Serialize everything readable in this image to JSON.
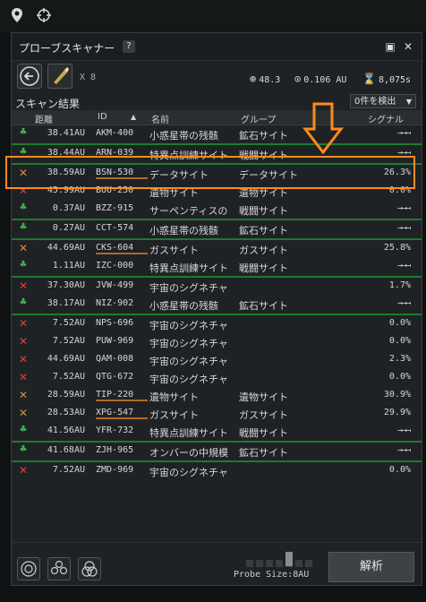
{
  "window": {
    "title": "プローブスキャナー",
    "help": "?"
  },
  "toolbar": {
    "probe_count": "X 8",
    "stat1": "48.3",
    "stat2": "0.106 AU",
    "stat3": "8,075s"
  },
  "results": {
    "label": "スキャン結果",
    "detect": "0件を検出"
  },
  "columns": [
    "距離",
    "ID",
    "名前",
    "グループ",
    "シグナル"
  ],
  "rows": [
    {
      "type": "green",
      "dist": "38.41AU",
      "id": "AKM-400",
      "name": "小惑星帯の残骸",
      "group": "鉱石サイト",
      "signal": "→→→"
    },
    {
      "type": "green",
      "dist": "38.44AU",
      "id": "ARN-039",
      "name": "特異点訓練サイト",
      "group": "戦闘サイト",
      "signal": "→→→"
    },
    {
      "type": "x-or",
      "dist": "38.59AU",
      "id": "BSN-530",
      "name": "データサイト",
      "group": "データサイト",
      "signal": "26.3%"
    },
    {
      "type": "x-red",
      "dist": "45.99AU",
      "id": "BUU-250",
      "name": "遺物サイト",
      "group": "遺物サイト",
      "signal": "0.0%"
    },
    {
      "type": "green",
      "dist": "0.37AU",
      "id": "BZZ-915",
      "name": "サーペンティスの",
      "group": "戦闘サイト",
      "signal": "→→→"
    },
    {
      "type": "green",
      "dist": "0.27AU",
      "id": "CCT-574",
      "name": "小惑星帯の残骸",
      "group": "鉱石サイト",
      "signal": "→→→"
    },
    {
      "type": "x-or",
      "dist": "44.69AU",
      "id": "CKS-604",
      "name": "ガスサイト",
      "group": "ガスサイト",
      "signal": "25.8%"
    },
    {
      "type": "green",
      "dist": "1.11AU",
      "id": "IZC-000",
      "name": "特異点訓練サイト",
      "group": "戦闘サイト",
      "signal": "→→→"
    },
    {
      "type": "x-red",
      "dist": "37.30AU",
      "id": "JVW-499",
      "name": "宇宙のシグネチャ",
      "group": "",
      "signal": "1.7%"
    },
    {
      "type": "green",
      "dist": "38.17AU",
      "id": "NIZ-902",
      "name": "小惑星帯の残骸",
      "group": "鉱石サイト",
      "signal": "→→→"
    },
    {
      "type": "x-red",
      "dist": "7.52AU",
      "id": "NPS-696",
      "name": "宇宙のシグネチャ",
      "group": "",
      "signal": "0.0%"
    },
    {
      "type": "x-red",
      "dist": "7.52AU",
      "id": "PUW-969",
      "name": "宇宙のシグネチャ",
      "group": "",
      "signal": "0.0%"
    },
    {
      "type": "x-red",
      "dist": "44.69AU",
      "id": "QAM-008",
      "name": "宇宙のシグネチャ",
      "group": "",
      "signal": "2.3%"
    },
    {
      "type": "x-red",
      "dist": "7.52AU",
      "id": "QTG-672",
      "name": "宇宙のシグネチャ",
      "group": "",
      "signal": "0.0%"
    },
    {
      "type": "x-or",
      "dist": "28.59AU",
      "id": "TIP-220",
      "name": "遺物サイト",
      "group": "遺物サイト",
      "signal": "30.9%"
    },
    {
      "type": "x-or",
      "dist": "28.53AU",
      "id": "XPG-547",
      "name": "ガスサイト",
      "group": "ガスサイト",
      "signal": "29.9%"
    },
    {
      "type": "green",
      "dist": "41.56AU",
      "id": "YFR-732",
      "name": "特異点訓練サイト",
      "group": "戦闘サイト",
      "signal": "→→→"
    },
    {
      "type": "green",
      "dist": "41.68AU",
      "id": "ZJH-965",
      "name": "オンバーの中規模",
      "group": "鉱石サイト",
      "signal": "→→→"
    },
    {
      "type": "x-red",
      "dist": "7.52AU",
      "id": "ZMD-969",
      "name": "宇宙のシグネチャ",
      "group": "",
      "signal": "0.0%"
    }
  ],
  "bottom": {
    "probe_size": "Probe Size:8AU",
    "analyze": "解析"
  },
  "colors": {
    "accent_orange": "#ff8a1e",
    "green": "#3fb04a",
    "red": "#e23c3c"
  }
}
